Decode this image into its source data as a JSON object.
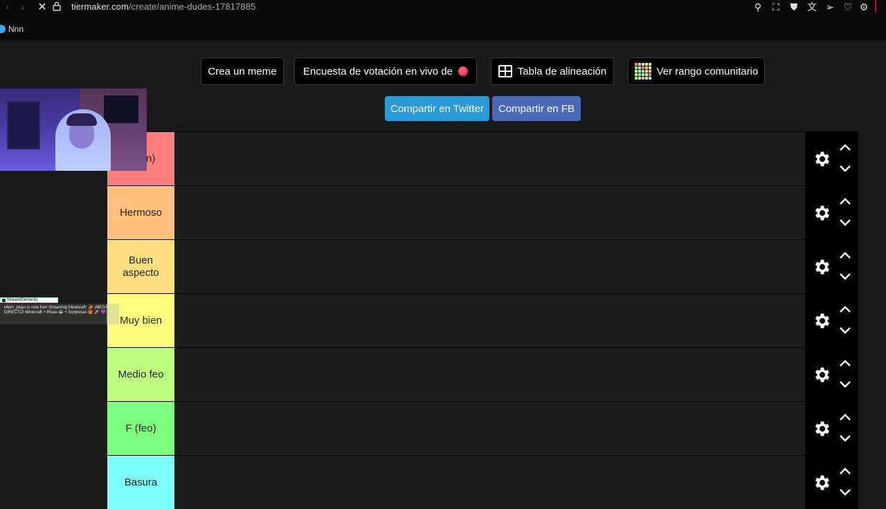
{
  "browser": {
    "url_host": "tiermaker.com",
    "url_path": "/create/anime-dudes-17817885",
    "bookmark_label": "Nnn"
  },
  "actions": {
    "meme_label": "Crea un meme",
    "vote_label": "Encuesta de votación en vivo de",
    "align_label": "Tabla de alineación",
    "community_label": "Ver rango comunitario",
    "twitter_label": "Compartir en Twitter",
    "fb_label": "Compartir en FB"
  },
  "colors": {
    "twitter": "#2a9ad8",
    "fb": "#4c69ba"
  },
  "tiers": [
    {
      "label": "a con)",
      "color": "#ff7f7f"
    },
    {
      "label": "Hermoso",
      "color": "#ffbf7f"
    },
    {
      "label": "Buen aspecto",
      "color": "#ffdf7f"
    },
    {
      "label": "Muy bien",
      "color": "#ffff7f"
    },
    {
      "label": "Medio feo",
      "color": "#bfff7f"
    },
    {
      "label": "F (feo)",
      "color": "#7fff7f"
    },
    {
      "label": "Basura",
      "color": "#7fffff"
    }
  ],
  "overlay": {
    "brand": "StreamElements",
    "message": "elkim_plays is now live! Streaming Minecraft: ✨ ¡MEGA DIRECTO! Minecraft + Risas 😂 + Sorpresas 🎁 🚀 💜"
  }
}
